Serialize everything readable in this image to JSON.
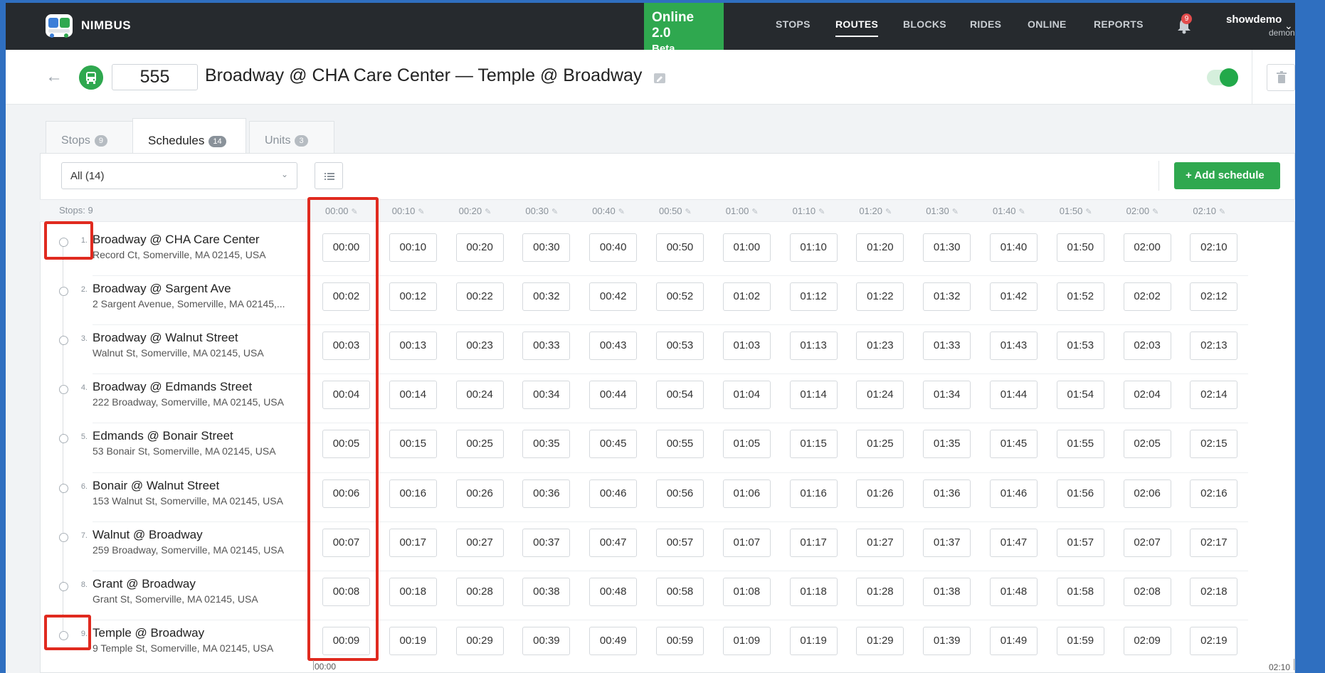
{
  "navbar": {
    "brand": "NIMBUS",
    "online_title": "Online 2.0",
    "online_sub": "Beta",
    "items": [
      "STOPS",
      "ROUTES",
      "BLOCKS",
      "RIDES",
      "ONLINE",
      "REPORTS"
    ],
    "active_item": "ROUTES",
    "notification_count": "9",
    "user_name": "showdemo",
    "user_org": "demona"
  },
  "route": {
    "number": "555",
    "title": "Broadway @ CHA Care Center — Temple @ Broadway",
    "enabled": true
  },
  "tabs": [
    {
      "label": "Stops",
      "count": "9",
      "active": false
    },
    {
      "label": "Schedules",
      "count": "14",
      "active": true
    },
    {
      "label": "Units",
      "count": "3",
      "active": false
    }
  ],
  "toolbar": {
    "filter_value": "All (14)",
    "add_label": "+ Add schedule"
  },
  "grid": {
    "stops_label": "Stops: 9",
    "columns": [
      "00:00",
      "00:10",
      "00:20",
      "00:30",
      "00:40",
      "00:50",
      "01:00",
      "01:10",
      "01:20",
      "01:30",
      "01:40",
      "01:50",
      "02:00",
      "02:10"
    ],
    "stops": [
      {
        "num": "1.",
        "name": "Broadway @ CHA Care Center",
        "address": "Record Ct, Somerville, MA 02145, USA",
        "times": [
          "00:00",
          "00:10",
          "00:20",
          "00:30",
          "00:40",
          "00:50",
          "01:00",
          "01:10",
          "01:20",
          "01:30",
          "01:40",
          "01:50",
          "02:00",
          "02:10"
        ]
      },
      {
        "num": "2.",
        "name": "Broadway @ Sargent Ave",
        "address": "2 Sargent Avenue, Somerville, MA 02145,...",
        "times": [
          "00:02",
          "00:12",
          "00:22",
          "00:32",
          "00:42",
          "00:52",
          "01:02",
          "01:12",
          "01:22",
          "01:32",
          "01:42",
          "01:52",
          "02:02",
          "02:12"
        ]
      },
      {
        "num": "3.",
        "name": "Broadway @ Walnut Street",
        "address": "Walnut St, Somerville, MA 02145, USA",
        "times": [
          "00:03",
          "00:13",
          "00:23",
          "00:33",
          "00:43",
          "00:53",
          "01:03",
          "01:13",
          "01:23",
          "01:33",
          "01:43",
          "01:53",
          "02:03",
          "02:13"
        ]
      },
      {
        "num": "4.",
        "name": "Broadway @ Edmands Street",
        "address": "222 Broadway, Somerville, MA 02145, USA",
        "times": [
          "00:04",
          "00:14",
          "00:24",
          "00:34",
          "00:44",
          "00:54",
          "01:04",
          "01:14",
          "01:24",
          "01:34",
          "01:44",
          "01:54",
          "02:04",
          "02:14"
        ]
      },
      {
        "num": "5.",
        "name": "Edmands @ Bonair Street",
        "address": "53 Bonair St, Somerville, MA 02145, USA",
        "times": [
          "00:05",
          "00:15",
          "00:25",
          "00:35",
          "00:45",
          "00:55",
          "01:05",
          "01:15",
          "01:25",
          "01:35",
          "01:45",
          "01:55",
          "02:05",
          "02:15"
        ]
      },
      {
        "num": "6.",
        "name": "Bonair @ Walnut Street",
        "address": "153 Walnut St, Somerville, MA 02145, USA",
        "times": [
          "00:06",
          "00:16",
          "00:26",
          "00:36",
          "00:46",
          "00:56",
          "01:06",
          "01:16",
          "01:26",
          "01:36",
          "01:46",
          "01:56",
          "02:06",
          "02:16"
        ]
      },
      {
        "num": "7.",
        "name": "Walnut @ Broadway",
        "address": "259 Broadway, Somerville, MA 02145, USA",
        "times": [
          "00:07",
          "00:17",
          "00:27",
          "00:37",
          "00:47",
          "00:57",
          "01:07",
          "01:17",
          "01:27",
          "01:37",
          "01:47",
          "01:57",
          "02:07",
          "02:17"
        ]
      },
      {
        "num": "8.",
        "name": "Grant @ Broadway",
        "address": "Grant St, Somerville, MA 02145, USA",
        "times": [
          "00:08",
          "00:18",
          "00:28",
          "00:38",
          "00:48",
          "00:58",
          "01:08",
          "01:18",
          "01:28",
          "01:38",
          "01:48",
          "01:58",
          "02:08",
          "02:18"
        ]
      },
      {
        "num": "9.",
        "name": "Temple @ Broadway",
        "address": "9 Temple St, Somerville, MA 02145, USA",
        "times": [
          "00:09",
          "00:19",
          "00:29",
          "00:39",
          "00:49",
          "00:59",
          "01:09",
          "01:19",
          "01:29",
          "01:39",
          "01:49",
          "01:59",
          "02:09",
          "02:19"
        ]
      }
    ],
    "timeline_start": "00:00",
    "timeline_end": "02:10"
  },
  "colors": {
    "accent_green": "#2fa84f",
    "navbar_bg": "#262a2e",
    "highlight_red": "#e02a1f"
  }
}
